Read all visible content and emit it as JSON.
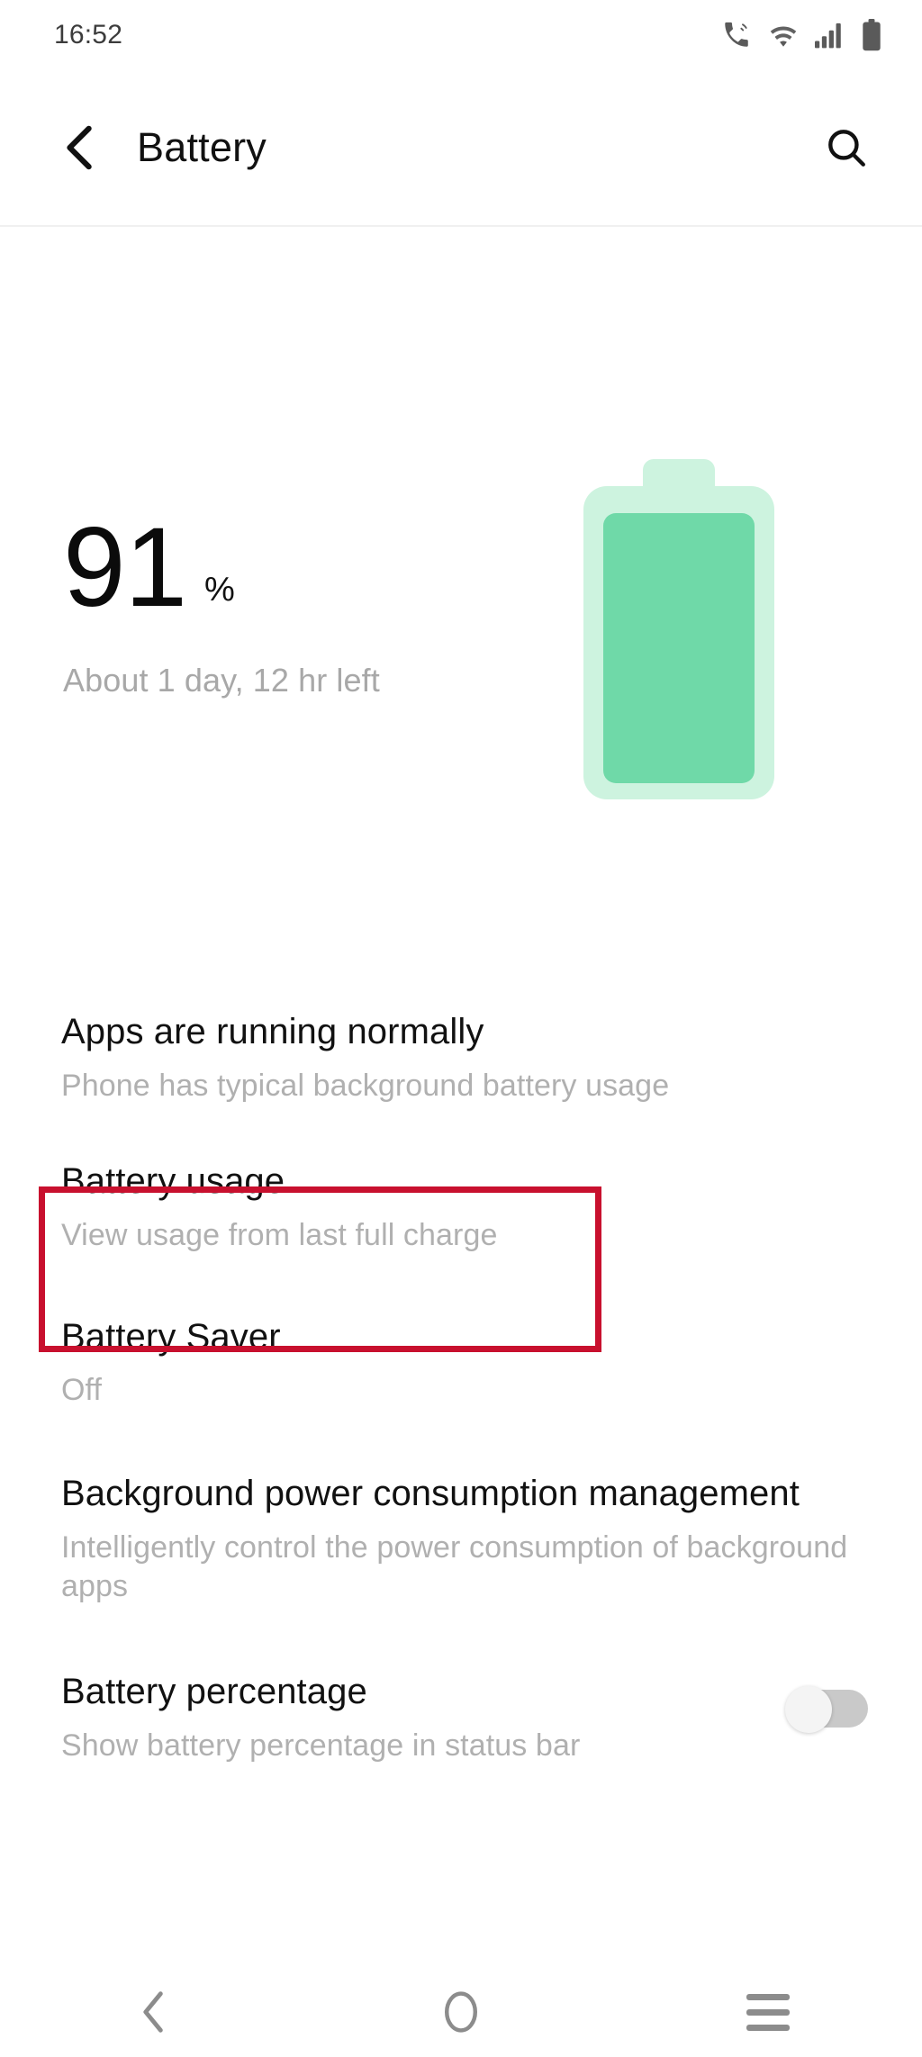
{
  "status_bar": {
    "time": "16:52",
    "icons": [
      "volte-call-icon",
      "wifi-icon",
      "cellular-signal-icon",
      "battery-icon"
    ]
  },
  "app_bar": {
    "title": "Battery",
    "back_icon": "chevron-left-icon",
    "search_icon": "search-icon"
  },
  "battery_summary": {
    "percent": "91",
    "percent_symbol": "%",
    "time_remaining": "About 1 day, 12 hr left",
    "fill_color": "#6fd9a8",
    "shell_color": "#cdf3df",
    "fill_level": 91
  },
  "settings": {
    "status": {
      "title": "Apps are running normally",
      "subtitle": "Phone has typical background battery usage"
    },
    "battery_usage": {
      "title": "Battery usage",
      "subtitle": "View usage from last full charge",
      "highlight_color": "#c8102e"
    },
    "battery_saver": {
      "title": "Battery Saver",
      "subtitle": "Off"
    },
    "background_power": {
      "title": "Background power consumption management",
      "subtitle": "Intelligently control the power consumption of background apps"
    },
    "battery_percentage": {
      "title": "Battery percentage",
      "subtitle": "Show battery percentage in status bar",
      "toggle_state": "off"
    }
  },
  "nav_bar": {
    "back_icon": "nav-back-icon",
    "home_icon": "nav-home-icon",
    "recents_icon": "nav-recents-icon"
  }
}
